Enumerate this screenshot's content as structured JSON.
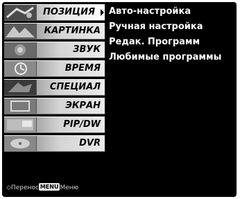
{
  "menu": {
    "items": [
      {
        "label": "ПОЗИЦИЯ",
        "icon": "position-icon",
        "active": true
      },
      {
        "label": "КАРТИНКА",
        "icon": "picture-icon",
        "active": false
      },
      {
        "label": "ЗВУК",
        "icon": "sound-icon",
        "active": false
      },
      {
        "label": "ВРЕМЯ",
        "icon": "time-icon",
        "active": false
      },
      {
        "label": "СПЕЦИАЛ",
        "icon": "special-icon",
        "active": false
      },
      {
        "label": "ЭКРАН",
        "icon": "screen-icon",
        "active": false
      },
      {
        "label": "PIP/DW",
        "icon": "pip-icon",
        "active": false
      },
      {
        "label": "DVR",
        "icon": "dvr-icon",
        "active": false
      }
    ]
  },
  "footer": {
    "move_label": "Перенос",
    "menu_key": "MENU",
    "menu_label": "Меню"
  },
  "submenu": {
    "items": [
      "Авто-настройка",
      "Ручная настройка",
      "Редак. Программ",
      "Любимые программы"
    ]
  }
}
